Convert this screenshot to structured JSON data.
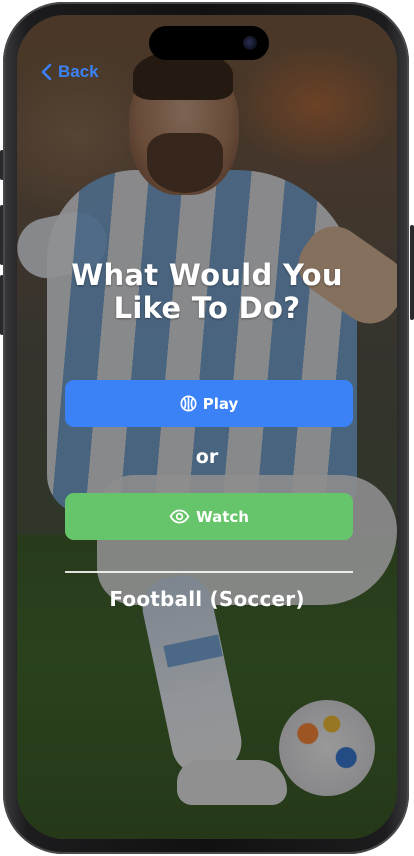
{
  "nav": {
    "back_label": "Back",
    "back_icon": "chevron-left-icon"
  },
  "main": {
    "title_line1": "What Would You",
    "title_line2": "Like To Do?",
    "play_label": "Play",
    "play_icon": "basketball-icon",
    "or_label": "or",
    "watch_label": "Watch",
    "watch_icon": "eye-icon",
    "sport_label": "Football (Soccer)"
  },
  "colors": {
    "accent_blue": "#3b82f6",
    "accent_green": "#66c56a",
    "text": "#ffffff"
  },
  "background": {
    "image_subject": "soccer player kicking ball"
  }
}
